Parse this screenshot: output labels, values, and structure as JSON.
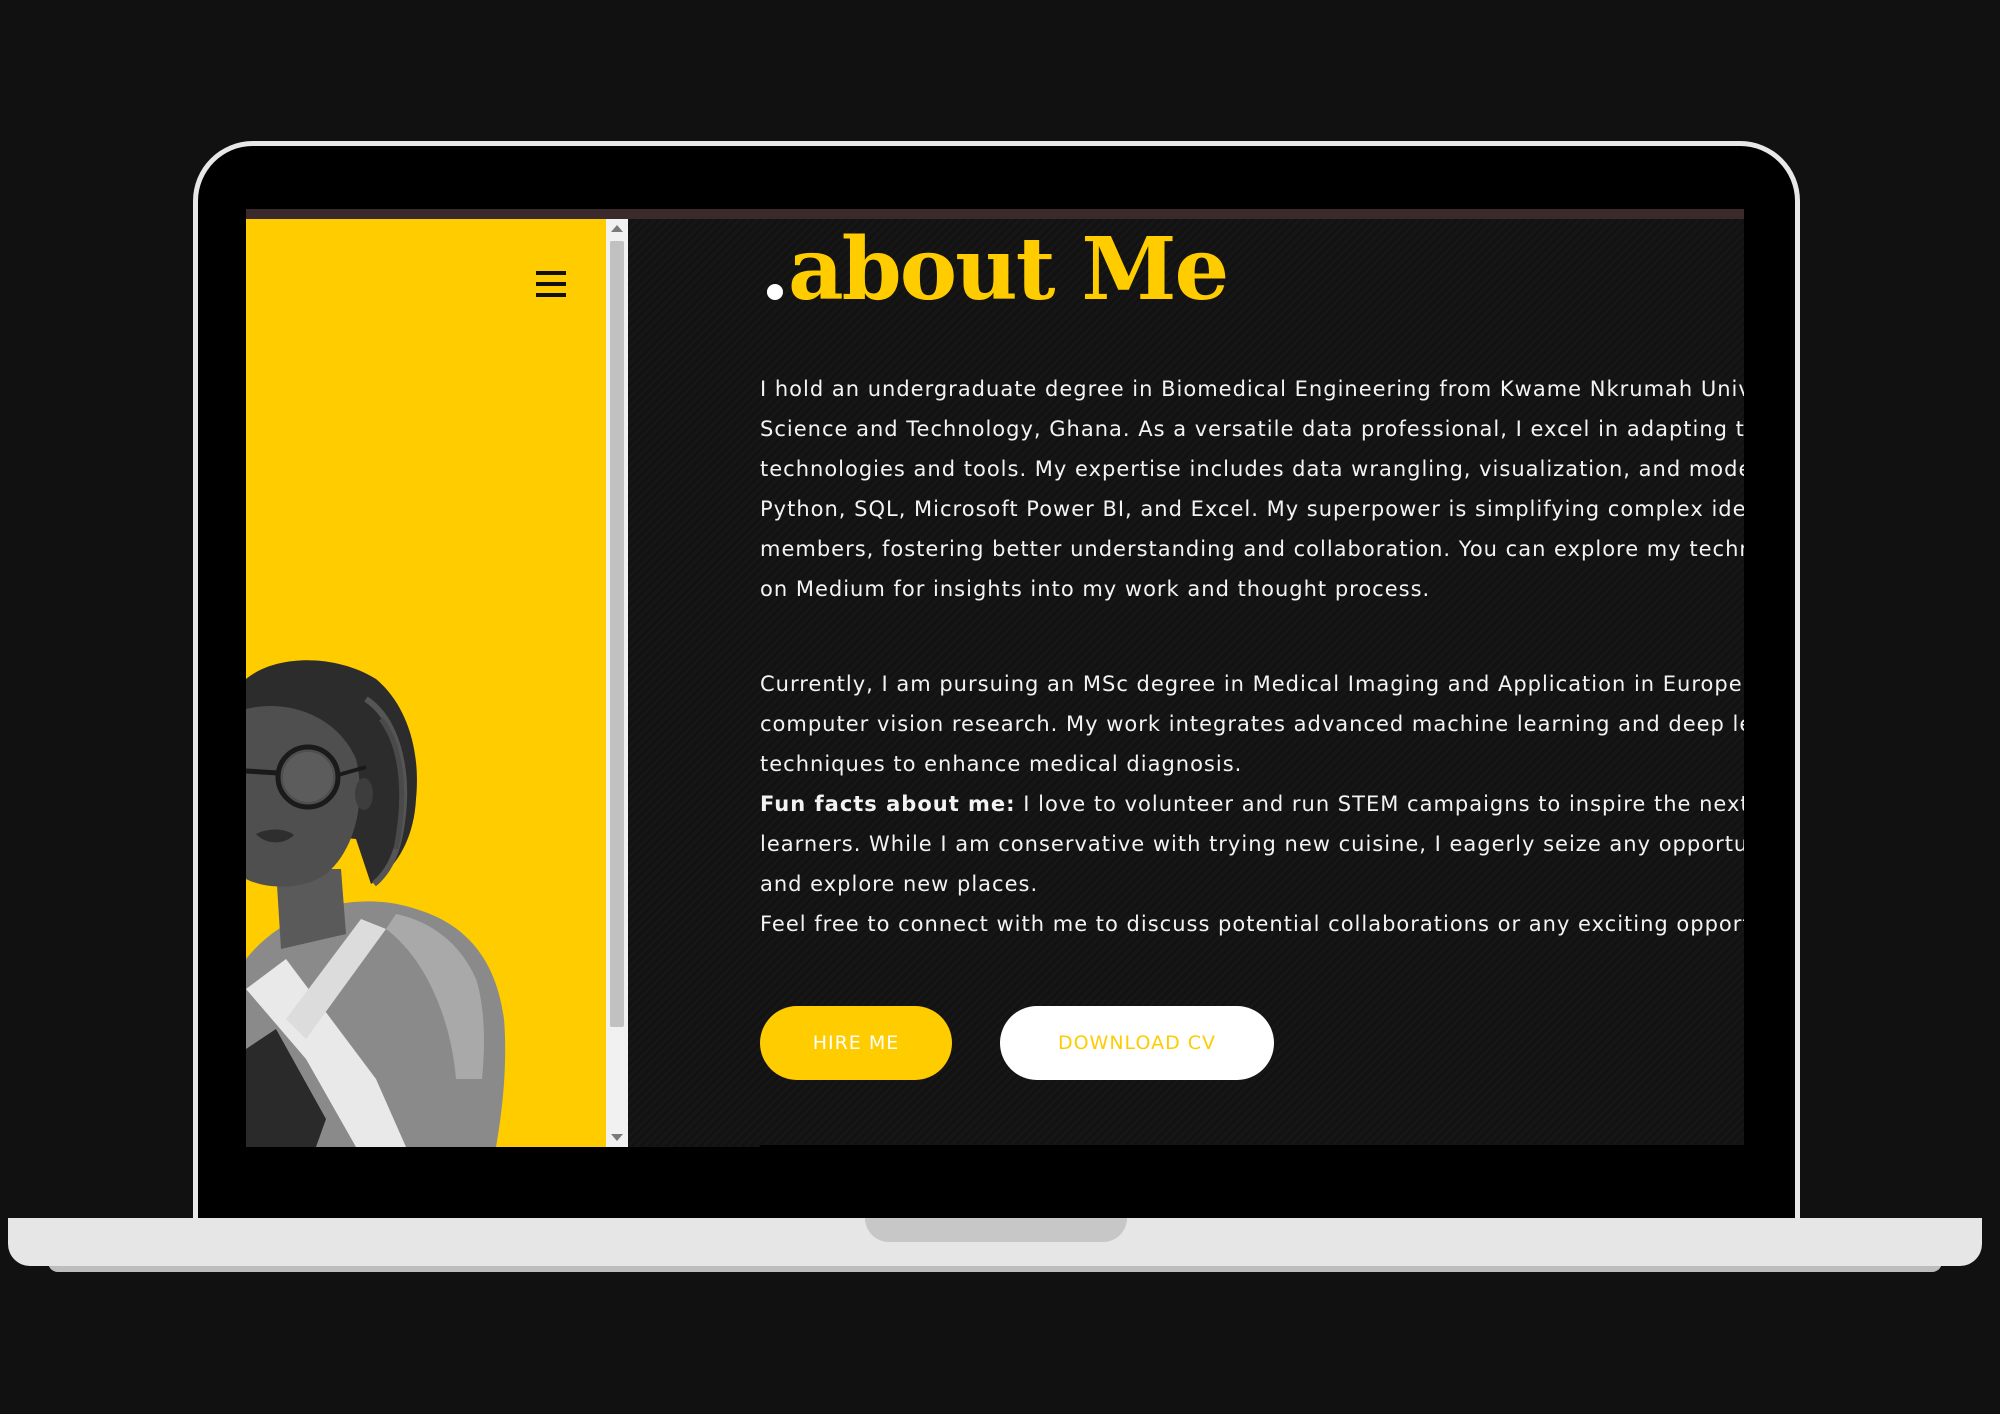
{
  "about": {
    "title_dot": ".",
    "title_text": "about Me",
    "para1_lines": [
      "I hold an undergraduate degree in Biomedical Engineering from Kwame Nkrumah Unive",
      "Science and Technology, Ghana. As a versatile data professional, I excel in adapting to",
      "technologies and tools. My expertise includes data wrangling, visualization, and modeli",
      "Python, SQL, Microsoft Power BI, and Excel. My superpower is simplifying complex ideas",
      "members, fostering better understanding and collaboration. You can explore my techn",
      "on Medium for insights into my work and thought process."
    ],
    "para2_lines": [
      "Currently, I am pursuing an MSc degree in Medical Imaging and Application in Europe, f",
      "computer vision research. My work integrates advanced machine learning and deep le",
      "techniques to enhance medical diagnosis."
    ],
    "fun_facts_label": "Fun facts about me:",
    "fun_facts_line1": " I love to volunteer and run STEM campaigns to inspire the next ger",
    "fun_facts_lines_rest": [
      "learners. While I am conservative with trying new cuisine, I eagerly seize any opportunit",
      "and explore new places."
    ],
    "closing_line": "Feel free to connect with me to discuss potential collaborations or any exciting opportu"
  },
  "buttons": {
    "hire_me": "HIRE ME",
    "download_cv": "DOWNLOAD CV"
  },
  "icons": {
    "menu": "hamburger-menu-icon"
  },
  "colors": {
    "accent": "#ffcc00",
    "background": "#111111",
    "text": "#f3f3f3"
  }
}
